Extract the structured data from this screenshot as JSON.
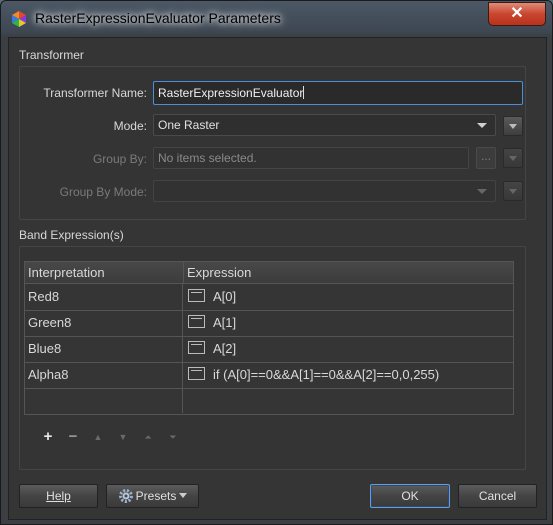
{
  "window": {
    "title": "RasterExpressionEvaluator Parameters",
    "close_label": "✕"
  },
  "transformer_section": {
    "label": "Transformer",
    "name_label": "Transformer Name:",
    "name_value": "RasterExpressionEvaluator",
    "mode_label": "Mode:",
    "mode_value": "One Raster",
    "group_by_label": "Group By:",
    "group_by_placeholder": "No items selected.",
    "group_by_ellipsis": "...",
    "group_by_mode_label": "Group By Mode:",
    "group_by_mode_value": ""
  },
  "band_section": {
    "label": "Band Expression(s)",
    "columns": [
      "Interpretation",
      "Expression"
    ],
    "rows": [
      {
        "interpretation": "Red8",
        "expression": "A[0]"
      },
      {
        "interpretation": "Green8",
        "expression": "A[1]"
      },
      {
        "interpretation": "Blue8",
        "expression": "A[2]"
      },
      {
        "interpretation": "Alpha8",
        "expression": "if (A[0]==0&&A[1]==0&&A[2]==0,0,255)"
      }
    ]
  },
  "toolbar": {
    "add": "+",
    "remove": "−",
    "move_up": "▲",
    "move_down": "▼",
    "move_top": "⏶",
    "move_bottom": "⏷"
  },
  "footer": {
    "help_label": "Help",
    "presets_label": "Presets",
    "ok_label": "OK",
    "cancel_label": "Cancel"
  },
  "colors": {
    "accent": "#4a90d9",
    "close_red": "#c8462f"
  }
}
